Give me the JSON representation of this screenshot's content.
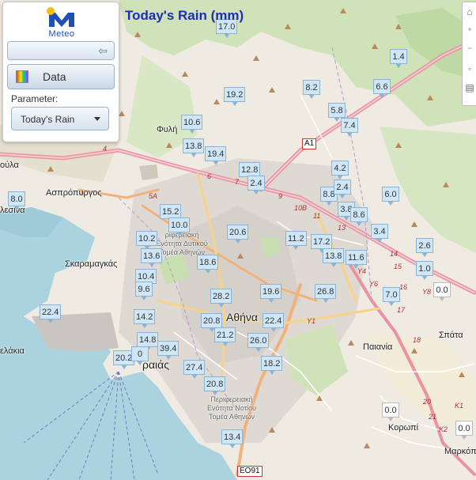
{
  "title": "Today's Rain (mm)",
  "panel": {
    "logo_text": "Meteo",
    "data_button": "Data",
    "parameter_label": "Parameter:",
    "parameter_value": "Today's Rain"
  },
  "markers": [
    {
      "label": "17.0",
      "zero": false
    },
    {
      "label": "1.4",
      "zero": false
    },
    {
      "label": "8.2",
      "zero": false
    },
    {
      "label": "6.6",
      "zero": false
    },
    {
      "label": "19.2",
      "zero": false
    },
    {
      "label": "5.8",
      "zero": false
    },
    {
      "label": "10.6",
      "zero": false
    },
    {
      "label": "7.4",
      "zero": false
    },
    {
      "label": "13.8",
      "zero": false
    },
    {
      "label": "19.4",
      "zero": false
    },
    {
      "label": "4.2",
      "zero": false
    },
    {
      "label": "12.8",
      "zero": false
    },
    {
      "label": "2.4",
      "zero": false
    },
    {
      "label": "8.8",
      "zero": false
    },
    {
      "label": "2.4",
      "zero": false
    },
    {
      "label": "6.0",
      "zero": false
    },
    {
      "label": "8.0",
      "zero": false
    },
    {
      "label": "15.2",
      "zero": false
    },
    {
      "label": "3.8",
      "zero": false
    },
    {
      "label": "8.6",
      "zero": false
    },
    {
      "label": "10.0",
      "zero": false
    },
    {
      "label": "3.4",
      "zero": false
    },
    {
      "label": "20.6",
      "zero": false
    },
    {
      "label": "10.2",
      "zero": false
    },
    {
      "label": "11.2",
      "zero": false
    },
    {
      "label": "17.2",
      "zero": false
    },
    {
      "label": "2.6",
      "zero": false
    },
    {
      "label": "13.6",
      "zero": false
    },
    {
      "label": "13.8",
      "zero": false
    },
    {
      "label": "11.6",
      "zero": false
    },
    {
      "label": "18.6",
      "zero": false
    },
    {
      "label": "1.0",
      "zero": false
    },
    {
      "label": "10.4",
      "zero": false
    },
    {
      "label": "9.6",
      "zero": false
    },
    {
      "label": "19.6",
      "zero": false
    },
    {
      "label": "26.8",
      "zero": false
    },
    {
      "label": "0.0",
      "zero": true
    },
    {
      "label": "28.2",
      "zero": false
    },
    {
      "label": "7.0",
      "zero": false
    },
    {
      "label": "22.4",
      "zero": false
    },
    {
      "label": "14.2",
      "zero": false
    },
    {
      "label": "20.8",
      "zero": false
    },
    {
      "label": "22.4",
      "zero": false
    },
    {
      "label": "21.2",
      "zero": false
    },
    {
      "label": "14.8",
      "zero": false
    },
    {
      "label": "26.0",
      "zero": false
    },
    {
      "label": "39.4",
      "zero": false
    },
    {
      "label": "20.2",
      "zero": false
    },
    {
      "label": "0",
      "zero": false
    },
    {
      "label": "18.2",
      "zero": false
    },
    {
      "label": "27.4",
      "zero": false
    },
    {
      "label": "20.8",
      "zero": false
    },
    {
      "label": "0.0",
      "zero": true
    },
    {
      "label": "0.0",
      "zero": true
    },
    {
      "label": "13.4",
      "zero": false
    }
  ],
  "places": {
    "fyli": "Φυλή",
    "aspropyrgos": "Ασπρόπυργος",
    "skaramangas": "Σκαραμαγκάς",
    "athina": "Αθήνα",
    "peiraias": "ραιάς",
    "paiania": "Παιανία",
    "spata": "Σπάτα",
    "koropi": "Κορωπί",
    "markopoulo": "Μαρκόπ",
    "elefsina": "λεσινα",
    "voula": "ούλα",
    "kelakia": "ελάκια",
    "notios": "Περιφερειακή Ενότητα Νοτίου Τομέα Αθηνών",
    "dytikos": "ριφερειακή Ενότητα Δυτικού Τομέα Αθηνών"
  },
  "roads": {
    "a1": "A1",
    "eo91": "EO91",
    "y1": "Y1",
    "y4": "Y4",
    "y6": "Y6",
    "y8": "Y8",
    "k1": "K1",
    "k2": "K2",
    "r10b": "10B",
    "r5a": "5A",
    "r14": "14",
    "r15": "15",
    "r17": "17",
    "r18": "18",
    "r20": "20",
    "r4": "4",
    "r6": "6",
    "r7": "7",
    "r9": "9",
    "r11": "11",
    "r13": "13",
    "r16": "16",
    "r21": "21"
  }
}
